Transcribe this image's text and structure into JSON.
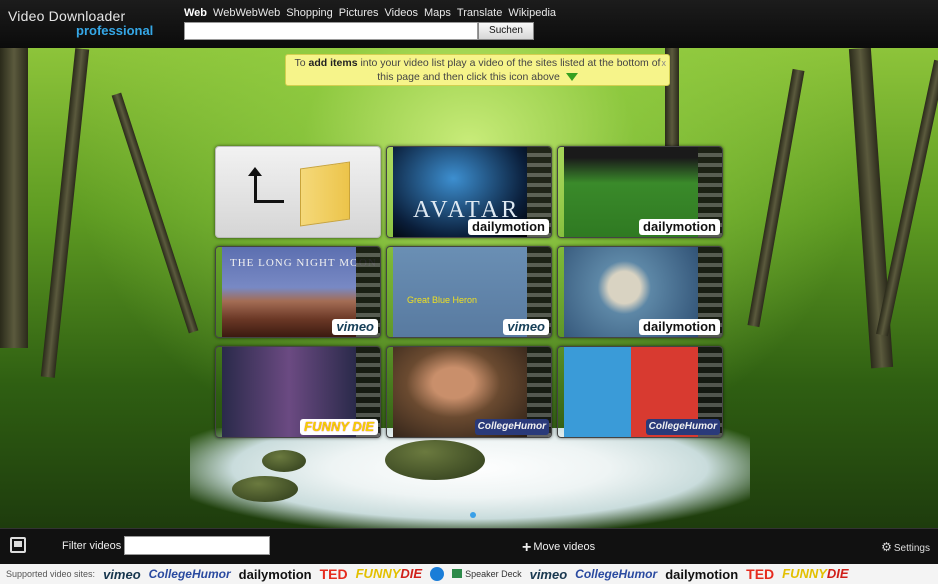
{
  "header": {
    "title": "Video Downloader",
    "subtitle": "professional",
    "nav": [
      "Web",
      "WebWebWeb",
      "Shopping",
      "Pictures",
      "Videos",
      "Maps",
      "Translate",
      "Wikipedia"
    ],
    "search": {
      "value": "",
      "placeholder": "",
      "button_label": "Suchen"
    }
  },
  "notice": {
    "prefix": "To ",
    "bold": "add items",
    "line1": " into your video list play a video of the sites listed at the bottom of",
    "line2": "this page and then click this icon above",
    "close_label": "x"
  },
  "tiles": [
    {
      "type": "back",
      "site": ""
    },
    {
      "type": "video",
      "text": "AVATAR",
      "site": "dailymotion"
    },
    {
      "type": "video",
      "text": "",
      "site": "dailymotion"
    },
    {
      "type": "video",
      "text": "THE LONG NIGHT MOON",
      "site": "vimeo"
    },
    {
      "type": "video",
      "text": "Great Blue Heron",
      "site": "vimeo"
    },
    {
      "type": "video",
      "text": "",
      "site": "dailymotion"
    },
    {
      "type": "video",
      "text": "",
      "site": "FUNNY DIE"
    },
    {
      "type": "video",
      "text": "",
      "site": "CollegeHumor"
    },
    {
      "type": "video",
      "text": "",
      "site": "CollegeHumor"
    }
  ],
  "bottombar": {
    "filter_label": "Filter videos",
    "filter_value": "",
    "move_label": "Move videos",
    "settings_label": "Settings"
  },
  "sites_bar": {
    "label": "Supported video sites:",
    "logos": [
      "vimeo",
      "CollegeHumor",
      "dailymotion",
      "TED",
      "FUNNY",
      "DIE",
      "Speaker Deck",
      "vimeo",
      "CollegeHumor",
      "dailymotion",
      "TED",
      "FUNNY",
      "DIE"
    ]
  },
  "colors": {
    "brand_blue": "#35a7e6",
    "notice_bg": "#f6f48a",
    "accent_dot": "#3aa0e8"
  },
  "icons": [
    "gallery-icon",
    "plus-icon",
    "gear-icon",
    "down-arrow-icon",
    "folder-icon",
    "up-arrow-icon"
  ]
}
